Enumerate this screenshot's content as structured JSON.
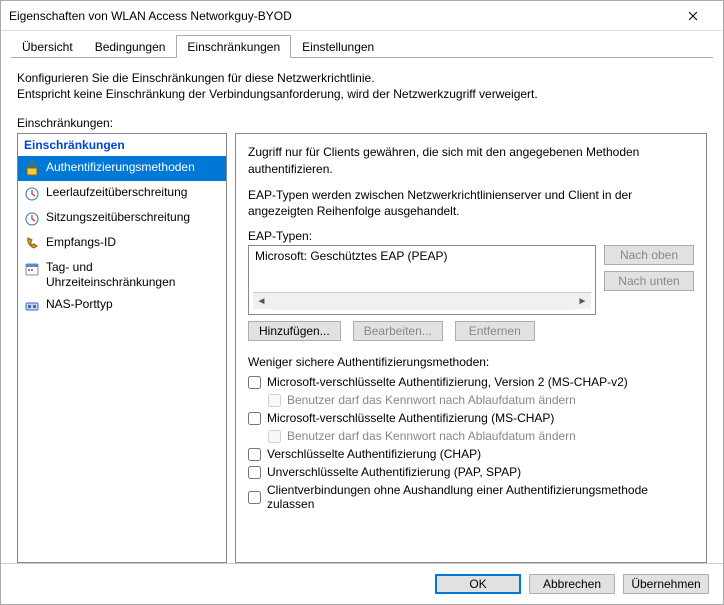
{
  "window": {
    "title": "Eigenschaften von WLAN Access Networkguy-BYOD"
  },
  "tabs": {
    "t0": "Übersicht",
    "t1": "Bedingungen",
    "t2": "Einschränkungen",
    "t3": "Einstellungen"
  },
  "intro": {
    "line1": "Konfigurieren Sie die Einschränkungen für diese Netzwerkrichtlinie.",
    "line2": "Entspricht keine Einschränkung der Verbindungsanforderung, wird der Netzwerkzugriff verweigert."
  },
  "left": {
    "caption": "Einschränkungen:",
    "header": "Einschränkungen",
    "items": {
      "auth": "Authentifizierungsmethoden",
      "idle": "Leerlaufzeitüberschreitung",
      "sess": "Sitzungszeitüberschreitung",
      "call": "Empfangs-ID",
      "day": "Tag- und Uhrzeiteinschränkungen",
      "nas": "NAS-Porttyp"
    }
  },
  "right": {
    "p1": "Zugriff nur für Clients gewähren, die sich mit den angegebenen Methoden authentifizieren.",
    "p2": "EAP-Typen werden zwischen Netzwerkrichtlinienserver und Client in der angezeigten Reihenfolge ausgehandelt.",
    "eap_label": "EAP-Typen:",
    "eap_items": [
      "Microsoft: Geschütztes EAP (PEAP)"
    ],
    "buttons": {
      "up": "Nach oben",
      "down": "Nach unten",
      "add": "Hinzufügen...",
      "edit": "Bearbeiten...",
      "remove": "Entfernen"
    },
    "less_secure_label": "Weniger sichere Authentifizierungsmethoden:",
    "checks": {
      "c1": "Microsoft-verschlüsselte Authentifizierung, Version 2 (MS-CHAP-v2)",
      "c1a": "Benutzer darf das Kennwort nach Ablaufdatum ändern",
      "c2": "Microsoft-verschlüsselte Authentifizierung (MS-CHAP)",
      "c2a": "Benutzer darf das Kennwort nach Ablaufdatum ändern",
      "c3": "Verschlüsselte Authentifizierung (CHAP)",
      "c4": "Unverschlüsselte Authentifizierung (PAP, SPAP)",
      "c5": "Clientverbindungen ohne Aushandlung einer Authentifizierungsmethode zulassen"
    }
  },
  "footer": {
    "ok": "OK",
    "cancel": "Abbrechen",
    "apply": "Übernehmen"
  }
}
